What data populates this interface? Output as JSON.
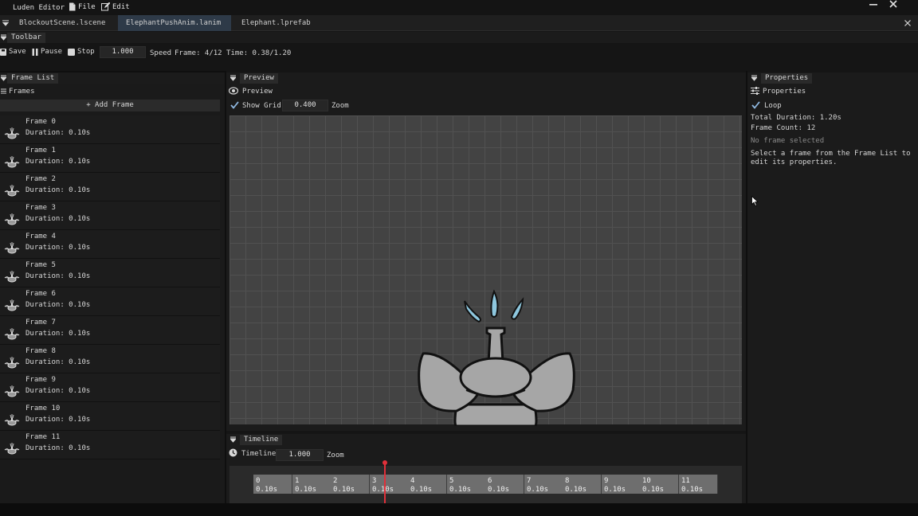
{
  "app": {
    "title": "Luden Editor",
    "menus": [
      "File",
      "Edit"
    ]
  },
  "tabs": [
    {
      "label": "BlockoutScene.lscene",
      "active": false
    },
    {
      "label": "ElephantPushAnim.lanim",
      "active": true,
      "modified": true
    },
    {
      "label": "Elephant.lprefab",
      "active": false
    }
  ],
  "toolbar": {
    "panel_label": "Toolbar",
    "save_label": "Save",
    "pause_label": "Pause",
    "stop_label": "Stop",
    "speed_value": "1.000",
    "speed_label": "Speed",
    "frame_status": "Frame: 4/12 Time: 0.38/1.20"
  },
  "frame_list": {
    "panel_label": "Frame List",
    "section_label": "Frames",
    "add_button": "+ Add Frame",
    "frames": [
      {
        "name": "Frame 0",
        "duration": "Duration: 0.10s"
      },
      {
        "name": "Frame 1",
        "duration": "Duration: 0.10s"
      },
      {
        "name": "Frame 2",
        "duration": "Duration: 0.10s"
      },
      {
        "name": "Frame 3",
        "duration": "Duration: 0.10s"
      },
      {
        "name": "Frame 4",
        "duration": "Duration: 0.10s"
      },
      {
        "name": "Frame 5",
        "duration": "Duration: 0.10s"
      },
      {
        "name": "Frame 6",
        "duration": "Duration: 0.10s"
      },
      {
        "name": "Frame 7",
        "duration": "Duration: 0.10s"
      },
      {
        "name": "Frame 8",
        "duration": "Duration: 0.10s"
      },
      {
        "name": "Frame 9",
        "duration": "Duration: 0.10s"
      },
      {
        "name": "Frame 10",
        "duration": "Duration: 0.10s"
      },
      {
        "name": "Frame 11",
        "duration": "Duration: 0.10s"
      }
    ]
  },
  "preview": {
    "panel_label": "Preview",
    "section_label": "Preview",
    "show_grid_label": "Show Grid",
    "show_grid_checked": true,
    "zoom_value": "0.400",
    "zoom_label": "Zoom"
  },
  "timeline": {
    "panel_label": "Timeline",
    "section_label": "Timeline",
    "zoom_value": "1.000",
    "zoom_label": "Zoom",
    "playhead_frame_fraction": 0.375,
    "cells": [
      {
        "index": "0",
        "duration": "0.10s"
      },
      {
        "index": "1",
        "duration": "0.10s"
      },
      {
        "index": "2",
        "duration": "0.10s"
      },
      {
        "index": "3",
        "duration": "0.10s"
      },
      {
        "index": "4",
        "duration": "0.10s"
      },
      {
        "index": "5",
        "duration": "0.10s"
      },
      {
        "index": "6",
        "duration": "0.10s"
      },
      {
        "index": "7",
        "duration": "0.10s"
      },
      {
        "index": "8",
        "duration": "0.10s"
      },
      {
        "index": "9",
        "duration": "0.10s"
      },
      {
        "index": "10",
        "duration": "0.10s"
      },
      {
        "index": "11",
        "duration": "0.10s"
      }
    ]
  },
  "properties": {
    "panel_label": "Properties",
    "section_label": "Properties",
    "loop_label": "Loop",
    "loop_checked": true,
    "total_duration": "Total Duration: 1.20s",
    "frame_count": "Frame Count: 12",
    "no_selection": "No frame selected",
    "hint": "Select a frame from the Frame List to edit its properties."
  },
  "colors": {
    "accent": "#2e3a48",
    "playhead": "#e0303a",
    "droplet": "#8ec7de",
    "elephant": "#a6a6a6"
  }
}
